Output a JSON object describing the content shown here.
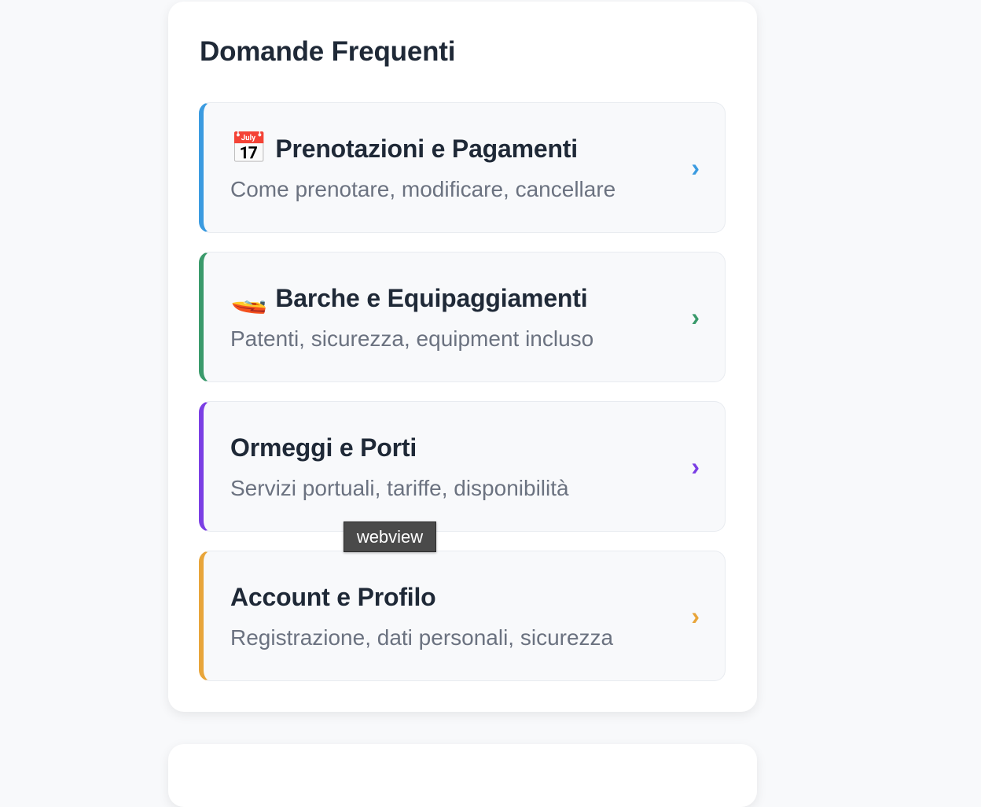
{
  "faq": {
    "title": "Domande Frequenti",
    "items": [
      {
        "icon": "calendar-icon",
        "emoji": "📅",
        "title": "Prenotazioni e Pagamenti",
        "description": "Come prenotare, modificare, cancellare",
        "accent_color": "#3b9be0",
        "chevron": "›"
      },
      {
        "icon": "speedboat-icon",
        "emoji": "🚤",
        "title": "Barche e Equipaggiamenti",
        "description": "Patenti, sicurezza, equipment incluso",
        "accent_color": "#3a9a6b",
        "chevron": "›"
      },
      {
        "title": "Ormeggi e Porti",
        "description": "Servizi portuali, tariffe, disponibilità",
        "accent_color": "#7b3fe4",
        "chevron": "›"
      },
      {
        "title": "Account e Profilo",
        "description": "Registrazione, dati personali, sicurezza",
        "accent_color": "#e8a53a",
        "chevron": "›"
      }
    ]
  },
  "tooltip": {
    "text": "webview"
  }
}
